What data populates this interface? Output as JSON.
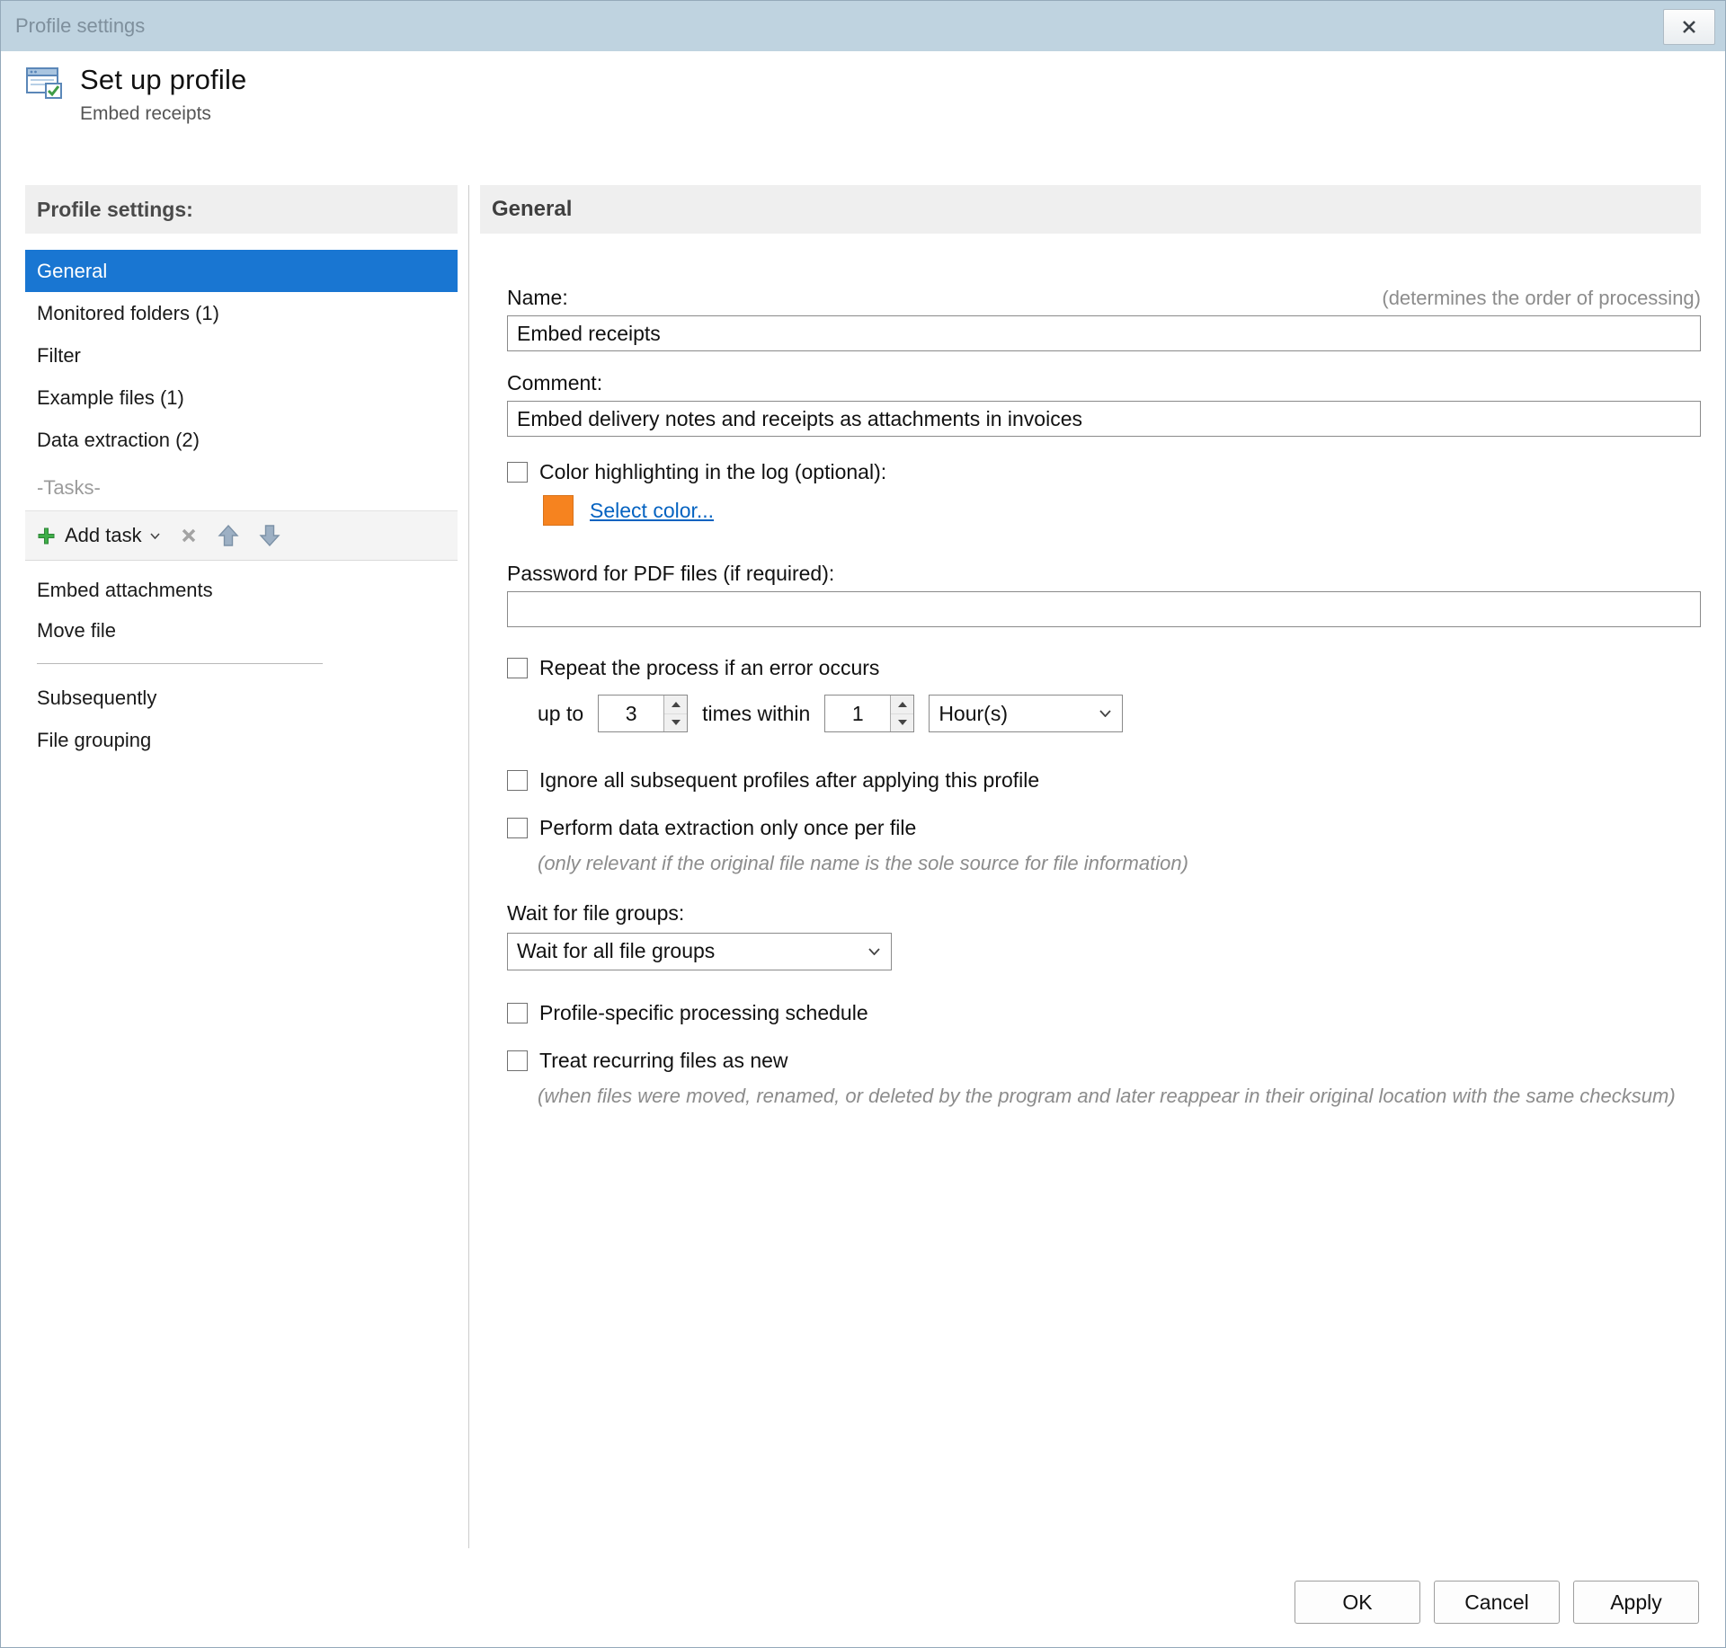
{
  "window": {
    "title": "Profile settings"
  },
  "header": {
    "title": "Set up profile",
    "subtitle": "Embed receipts"
  },
  "sidebar": {
    "heading": "Profile settings:",
    "items": [
      {
        "label": "General",
        "selected": true
      },
      {
        "label": "Monitored folders (1)",
        "selected": false
      },
      {
        "label": "Filter",
        "selected": false
      },
      {
        "label": "Example files (1)",
        "selected": false
      },
      {
        "label": "Data extraction (2)",
        "selected": false
      }
    ],
    "tasks_label": "-Tasks-",
    "toolbar": {
      "add_task_label": "Add task"
    },
    "task_items": [
      {
        "label": "Embed attachments"
      },
      {
        "label": "Move file"
      }
    ],
    "bottom_items": [
      {
        "label": "Subsequently"
      },
      {
        "label": "File grouping"
      }
    ]
  },
  "content": {
    "heading": "General",
    "name": {
      "label": "Name:",
      "hint": "(determines the order of processing)",
      "value": "Embed receipts"
    },
    "comment": {
      "label": "Comment:",
      "value": "Embed delivery notes and receipts as attachments in invoices"
    },
    "color_highlighting": {
      "label": "Color highlighting in the log (optional):",
      "checked": false,
      "link": "Select color..."
    },
    "password": {
      "label": "Password for PDF files (if required):",
      "value": ""
    },
    "repeat": {
      "label": "Repeat the process if an error occurs",
      "checked": false,
      "prefix": "up to",
      "times_value": "3",
      "middle": "times within",
      "within_value": "1",
      "unit": "Hour(s)"
    },
    "ignore": {
      "label": "Ignore all subsequent profiles after applying this profile",
      "checked": false
    },
    "extraction_once": {
      "label": "Perform data extraction only once per file",
      "checked": false,
      "note": "(only relevant if the original file name is the sole source for file information)"
    },
    "wait_groups": {
      "label": "Wait for file groups:",
      "value": "Wait for all file groups"
    },
    "schedule": {
      "label": "Profile-specific processing schedule",
      "checked": false
    },
    "recurring": {
      "label": "Treat recurring files as new",
      "checked": false,
      "note": "(when files were moved, renamed, or deleted by the program and later reappear in their original location with the same checksum)"
    }
  },
  "footer": {
    "ok": "OK",
    "cancel": "Cancel",
    "apply": "Apply"
  },
  "colors": {
    "accent": "#1976D2",
    "link": "#0563C1",
    "swatch": "#F6831F",
    "titlebar": "#BFD3E0"
  }
}
